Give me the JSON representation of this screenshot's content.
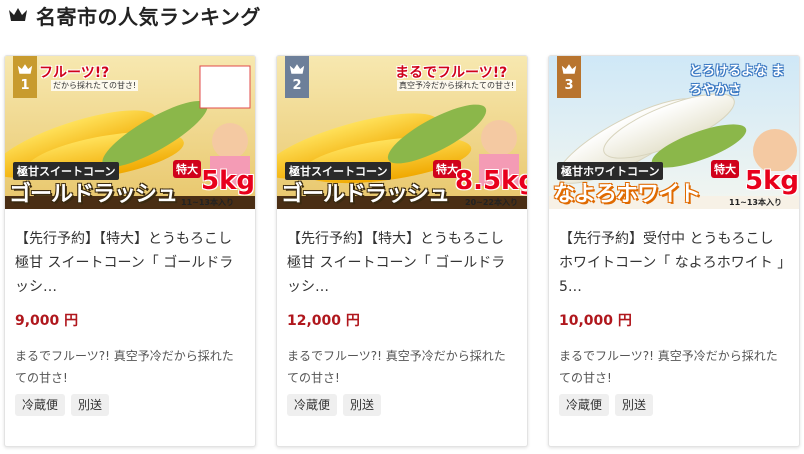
{
  "header": {
    "title": "名寄市の人気ランキング",
    "icon": "crown-icon"
  },
  "colors": {
    "gold": "#c89b2e",
    "silver": "#6d7f99",
    "bronze": "#b8742e",
    "price": "#b0171d"
  },
  "products": [
    {
      "rank": "1",
      "banner_top": "フルーツ!?",
      "banner_sub": "だから採れたての甘さ!",
      "brand_small": "極甘スイートコーン",
      "brand_big": "ゴールドラッシュ",
      "size_badge": "特大",
      "weight": "5kg",
      "count": "11~13本入り",
      "name": "【先行予約】【特大】とうもろこし 極甘 スイートコーン「 ゴールドラッシ…",
      "price": "9,000 円",
      "desc": "まるでフルーツ?! 真空予冷だから採れたての甘さ!",
      "tags": [
        "冷蔵便",
        "別送"
      ]
    },
    {
      "rank": "2",
      "banner_top": "まるでフルーツ!?",
      "banner_sub": "真空予冷だから採れたての甘さ!",
      "brand_small": "極甘スイートコーン",
      "brand_big": "ゴールドラッシュ",
      "size_badge": "特大",
      "weight": "8.5kg",
      "count": "20~22本入り",
      "name": "【先行予約】【特大】とうもろこし 極甘 スイートコーン「 ゴールドラッシ…",
      "price": "12,000 円",
      "desc": "まるでフルーツ?! 真空予冷だから採れたての甘さ!",
      "tags": [
        "冷蔵便",
        "別送"
      ]
    },
    {
      "rank": "3",
      "banner_top": "とろけるよな まろやかさ",
      "banner_sub": "",
      "brand_small": "極甘ホワイトコーン",
      "brand_big": "なよろホワイト",
      "size_badge": "特大",
      "weight": "5kg",
      "count": "11~13本入り",
      "name": "【先行予約】受付中 とうもろこし ホワイトコーン「 なよろホワイト 」5…",
      "price": "10,000 円",
      "desc": "まるでフルーツ?! 真空予冷だから採れたての甘さ!",
      "tags": [
        "冷蔵便",
        "別送"
      ]
    }
  ]
}
